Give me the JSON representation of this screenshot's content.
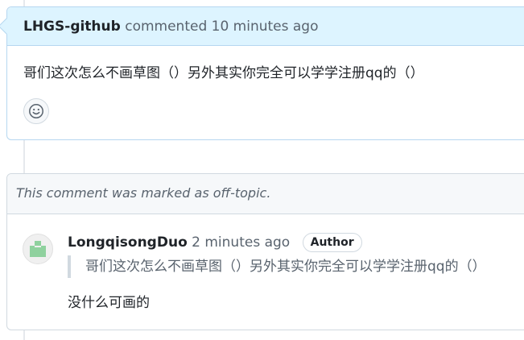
{
  "comment1": {
    "author": "LHGS-github",
    "meta": "commented 10 minutes ago",
    "body": "哥们这次怎么不画草图（）另外其实你完全可以学学注册qq的（）",
    "reaction_icon": "smiley-icon"
  },
  "comment2": {
    "banner": "This comment was marked as off-topic.",
    "author": "LongqisongDuo",
    "meta": "2 minutes ago",
    "badge": "Author",
    "quote": "哥们这次怎么不画草图（）另外其实你完全可以学学注册qq的（）",
    "body": "没什么可画的",
    "avatar_icon": "identicon-avatar"
  },
  "colors": {
    "header_blue": "#ddf4ff",
    "border_blue": "#b6d7f0",
    "banner_gray": "#f6f8fa",
    "avatar_green": "#8fd19e"
  }
}
